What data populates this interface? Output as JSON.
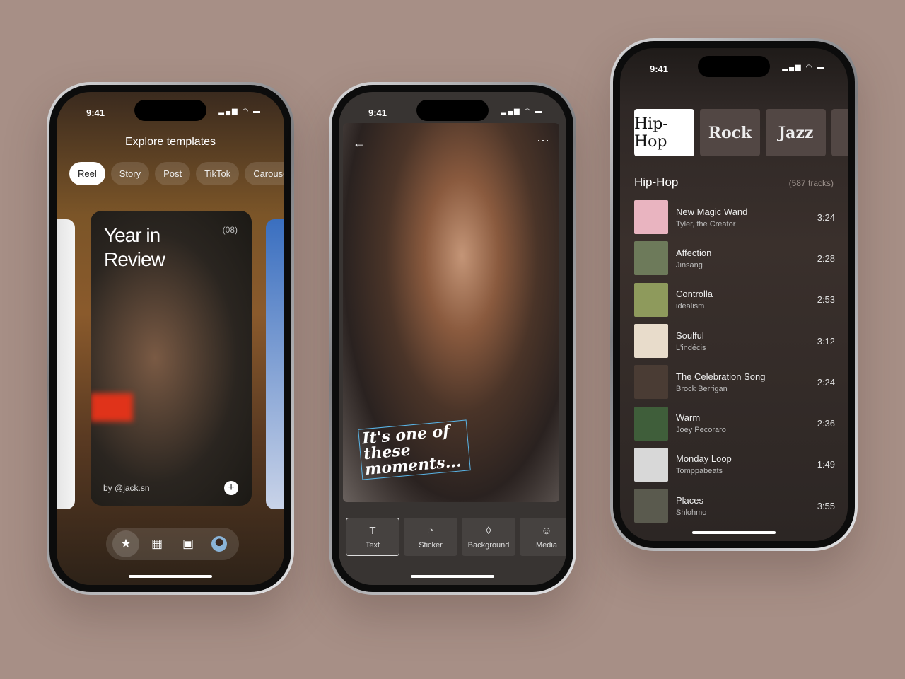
{
  "status": {
    "time": "9:41"
  },
  "templates": {
    "title": "Explore templates",
    "tabs": [
      "Reel",
      "Story",
      "Post",
      "TikTok",
      "Carousel"
    ],
    "card": {
      "title_line1": "Year in",
      "title_line2": "Review",
      "count": "(08)",
      "author": "by @jack.sn"
    },
    "nav": [
      "star-icon",
      "grid-icon",
      "calendar-icon",
      "avatar"
    ]
  },
  "editor": {
    "caption": "It's one of these moments...",
    "tools": [
      {
        "label": "Text",
        "icon": "T"
      },
      {
        "label": "Sticker",
        "icon": "◔"
      },
      {
        "label": "Background",
        "icon": "◊"
      },
      {
        "label": "Media",
        "icon": "☺"
      }
    ]
  },
  "music": {
    "genres": [
      "Hip-Hop",
      "Rock",
      "Jazz"
    ],
    "list_title": "Hip-Hop",
    "track_count": "(587 tracks)",
    "tracks": [
      {
        "title": "New Magic Wand",
        "artist": "Tyler, the Creator",
        "duration": "3:24",
        "color": "#e9b4c0"
      },
      {
        "title": "Affection",
        "artist": "Jinsang",
        "duration": "2:28",
        "color": "#6d7a5a"
      },
      {
        "title": "Controlla",
        "artist": "idealism",
        "duration": "2:53",
        "color": "#8e9a5c"
      },
      {
        "title": "Soulful",
        "artist": "L'indécis",
        "duration": "3:12",
        "color": "#e8dccb"
      },
      {
        "title": "The Celebration Song",
        "artist": "Brock Berrigan",
        "duration": "2:24",
        "color": "#4a3c34"
      },
      {
        "title": "Warm",
        "artist": "Joey Pecoraro",
        "duration": "2:36",
        "color": "#3f5e3a"
      },
      {
        "title": "Monday Loop",
        "artist": "Tomppabeats",
        "duration": "1:49",
        "color": "#d8d8d8"
      },
      {
        "title": "Places",
        "artist": "Shlohmo",
        "duration": "3:55",
        "color": "#5a5a4e"
      }
    ]
  }
}
